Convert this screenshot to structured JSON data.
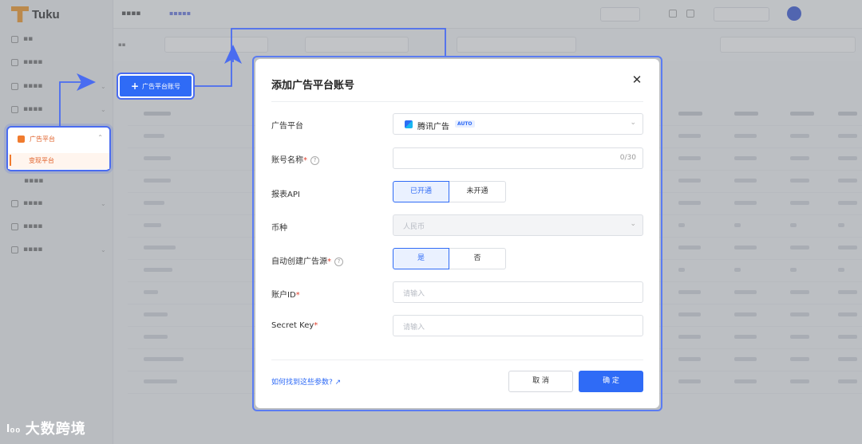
{
  "app": {
    "logo_text": "Tuku",
    "breadcrumb": "▪▪▪▪",
    "breadcrumb_tag": "▪▪▪▪▪"
  },
  "sidebar": {
    "items": [
      {
        "label": "▪▪"
      },
      {
        "label": "▪▪▪▪"
      },
      {
        "label": "▪▪▪▪"
      },
      {
        "label": "▪▪▪▪"
      },
      {
        "label": "广告平台"
      },
      {
        "label": "变现平台"
      },
      {
        "label": "▪▪▪▪"
      },
      {
        "label": "▪▪▪▪"
      },
      {
        "label": "▪▪▪▪"
      },
      {
        "label": "▪▪▪▪"
      }
    ]
  },
  "add_button": {
    "icon": "plus",
    "label": "广告平台账号"
  },
  "modal": {
    "title": "添加广告平台账号",
    "close_icon": "close-icon",
    "fields": {
      "platform": {
        "label": "广告平台",
        "value": "腾讯广告",
        "badge": "AUTO"
      },
      "account_name": {
        "label": "账号名称",
        "required": "*",
        "counter": "0/30"
      },
      "report_api": {
        "label": "报表API",
        "options": [
          "已开通",
          "未开通"
        ],
        "selected": "已开通"
      },
      "currency": {
        "label": "币种",
        "placeholder": "人民币"
      },
      "auto_create": {
        "label": "自动创建广告源",
        "required": "*",
        "options": [
          "是",
          "否"
        ],
        "selected": "是"
      },
      "account_id": {
        "label": "账户ID",
        "required": "*",
        "placeholder": "请输入"
      },
      "secret_key": {
        "label": "Secret Key",
        "required": "*",
        "placeholder": "请输入"
      }
    },
    "help_link": "如何找到这些参数?",
    "help_link_icon": "↗",
    "cancel_label": "取 消",
    "confirm_label": "确 定"
  },
  "watermark": {
    "logo": "I₀₀",
    "text": "大数跨境"
  },
  "colors": {
    "primary": "#2f6bf6",
    "highlight": "#4a6cf0",
    "accent_orange": "#f07b2e"
  }
}
